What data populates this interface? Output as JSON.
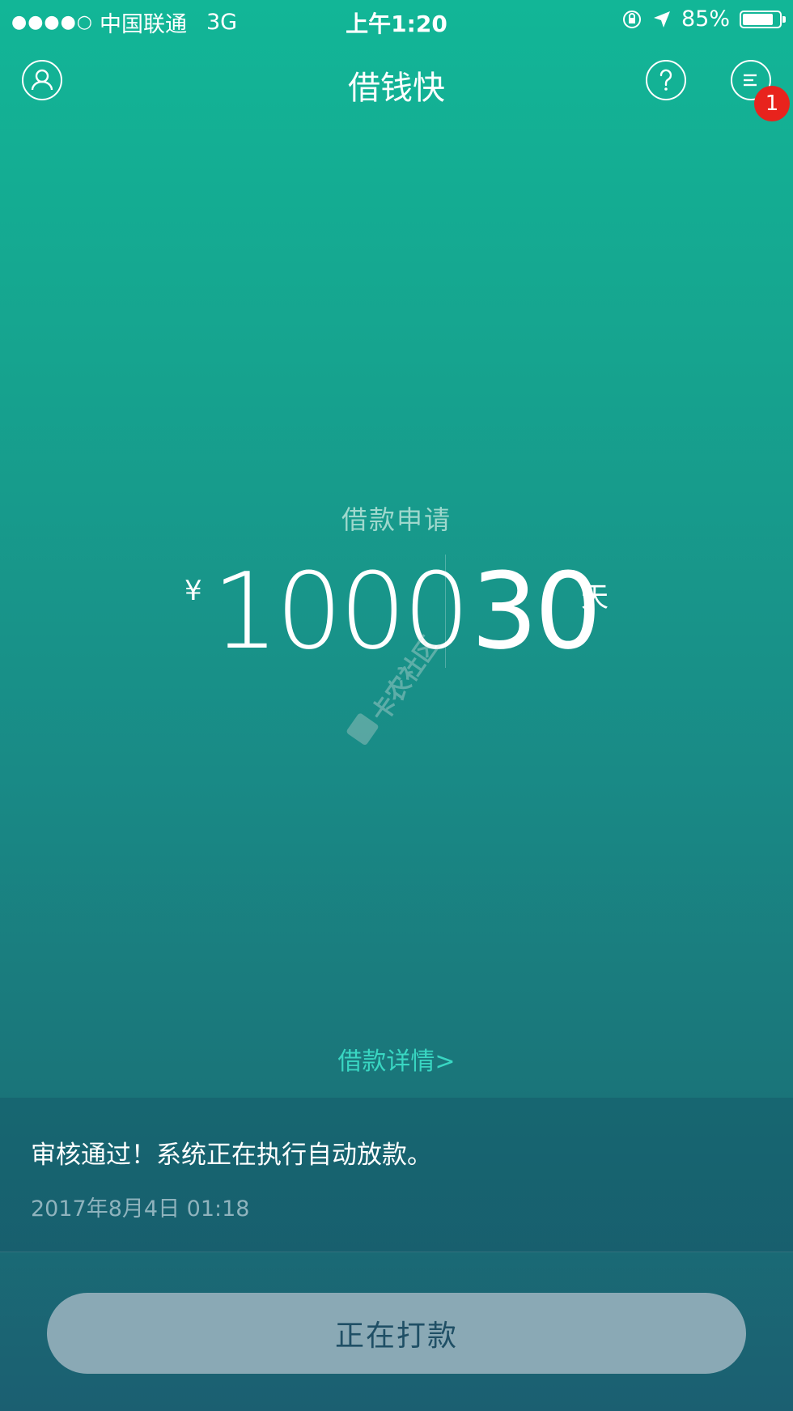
{
  "status_bar": {
    "signal": "●●●●○",
    "carrier": "中国联通",
    "network": "3G",
    "time": "上午1:20",
    "battery_percent": "85%",
    "battery_level": 0.85
  },
  "nav": {
    "title": "借钱快",
    "badge_count": "1"
  },
  "loan": {
    "label": "借款申请",
    "currency_symbol": "¥",
    "amount": "1000",
    "days": "30",
    "days_unit": "天"
  },
  "watermark": {
    "text": "卡农社区"
  },
  "detail_link": "借款详情>",
  "notice": {
    "message": "审核通过！系统正在执行自动放款。",
    "timestamp": "2017年8月4日 01:18"
  },
  "action_button": "正在打款",
  "icons": [
    "profile-icon",
    "help-icon",
    "message-icon",
    "lock-rotation-icon",
    "location-arrow-icon",
    "battery-icon"
  ]
}
